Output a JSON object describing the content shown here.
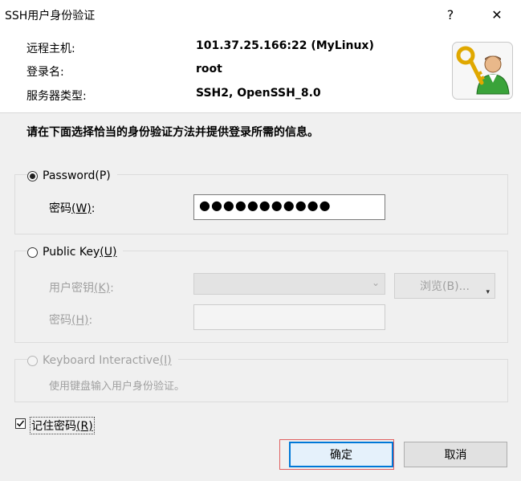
{
  "window": {
    "title": "SSH用户身份验证",
    "help_glyph": "?",
    "close_glyph": "✕"
  },
  "info": {
    "host_label": "远程主机:",
    "host_value": "101.37.25.166:22 (MyLinux)",
    "login_label": "登录名:",
    "login_value": "root",
    "server_type_label": "服务器类型:",
    "server_type_value": "SSH2, OpenSSH_8.0",
    "icon": "key-user-icon"
  },
  "instruction": "请在下面选择恰当的身份验证方法并提供登录所需的信息。",
  "password_group": {
    "radio_label": "Password",
    "radio_accel": "(P)",
    "selected": true,
    "field_label": "密码",
    "field_accel": "(W)",
    "field_suffix": ":",
    "masked_value": "●●●●●●●●●●●"
  },
  "publickey_group": {
    "radio_label": "Public Key",
    "radio_accel": "(U)",
    "selected": false,
    "key_label": "用户密钥",
    "key_accel": "(K)",
    "key_suffix": ":",
    "browse_label": "浏览(B)...",
    "passphrase_label": "密码",
    "passphrase_accel": "(H)",
    "passphrase_suffix": ":"
  },
  "keyboard_group": {
    "radio_label": "Keyboard Interactive",
    "radio_accel": "(I)",
    "selected": false,
    "description": "使用键盘输入用户身份验证。"
  },
  "remember": {
    "label": "记住密码",
    "accel": "(R)",
    "checked": true
  },
  "buttons": {
    "ok": "确定",
    "cancel": "取消"
  },
  "colors": {
    "accent": "#0078d7",
    "focus_ring": "#e06060"
  }
}
